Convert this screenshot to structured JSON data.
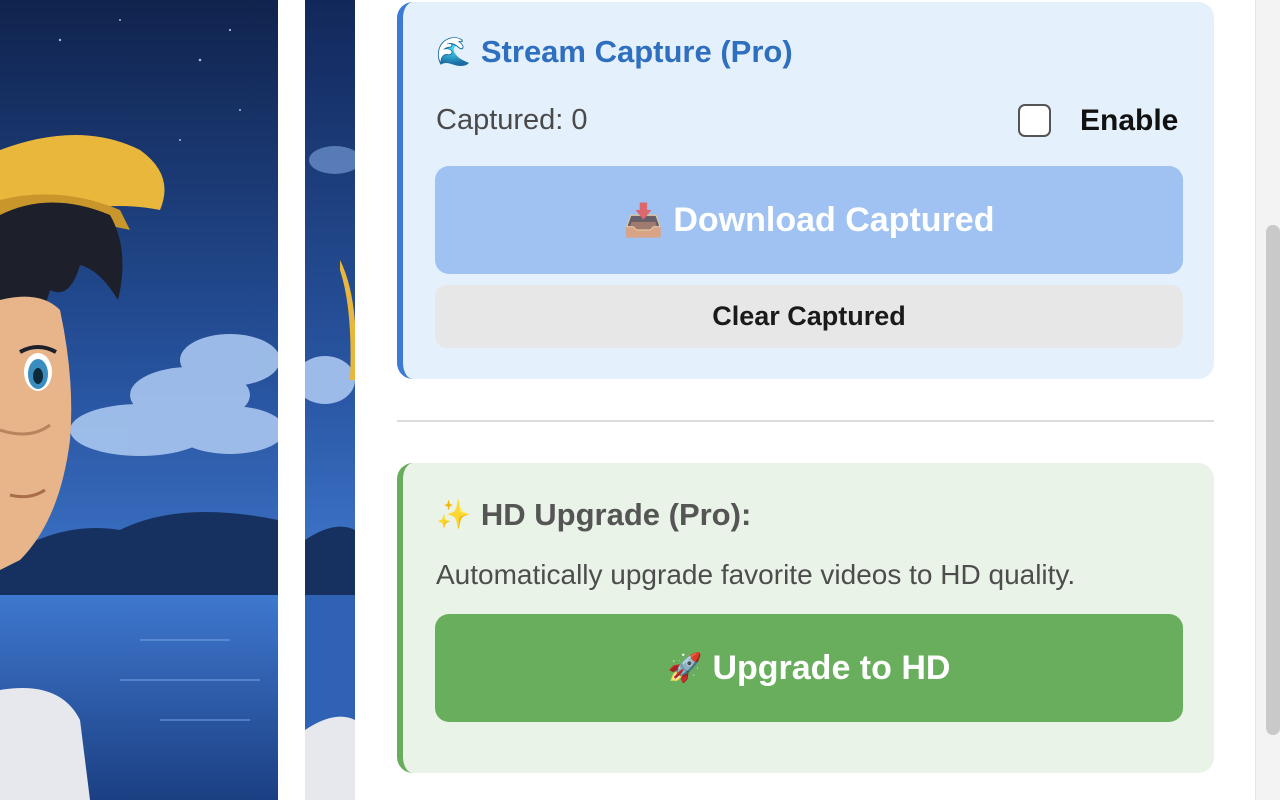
{
  "stream_capture": {
    "title": "Stream Capture (Pro)",
    "title_icon": "wave-icon",
    "captured_label": "Captured:",
    "captured_count": "0",
    "enable_label": "Enable",
    "enable_checked": false,
    "download_button": {
      "label": "Download Captured",
      "icon": "inbox-tray-icon",
      "disabled": true
    },
    "clear_button": {
      "label": "Clear Captured"
    },
    "accent_color": "#3b7bd6",
    "background_color": "#e4f0fb"
  },
  "hd_upgrade": {
    "title": "HD Upgrade (Pro):",
    "title_icon": "sparkles-icon",
    "description": "Automatically upgrade favorite videos to HD quality.",
    "upgrade_button": {
      "label": "Upgrade to HD",
      "icon": "rocket-icon"
    },
    "accent_color": "#67ad5b",
    "background_color": "#e9f3e7",
    "button_color": "#69ae5c"
  }
}
